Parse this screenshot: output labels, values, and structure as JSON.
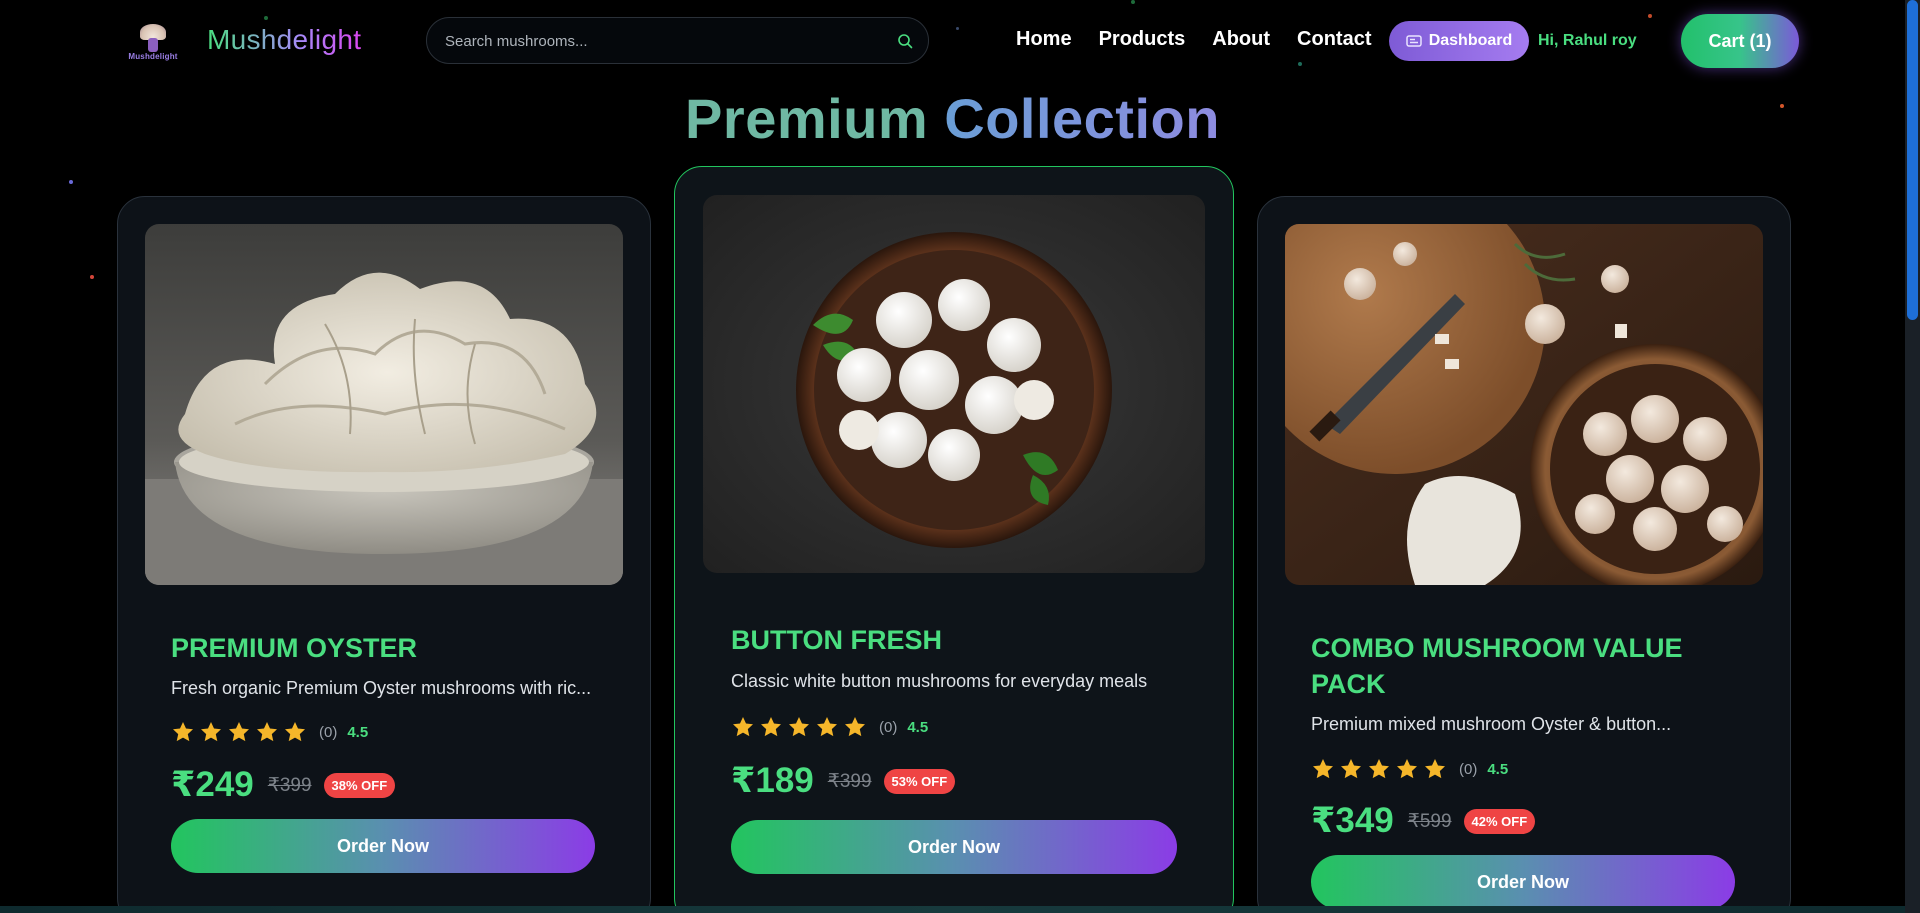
{
  "nav": {
    "logo_tiny_text": "Mushdelight",
    "brand": "Mushdelight",
    "search_placeholder": "Search mushrooms...",
    "links": [
      "Home",
      "Products",
      "About",
      "Contact"
    ],
    "dashboard_label": "Dashboard",
    "greeting": "Hi, Rahul roy",
    "cart_label": "Cart (1)"
  },
  "heading": {
    "word1": "Premium",
    "word2": "Collection"
  },
  "products": [
    {
      "title": "PREMIUM OYSTER",
      "description": "Fresh organic Premium Oyster mushrooms with ric...",
      "stars": 5,
      "reviews": "(0)",
      "rating": "4.5",
      "price": "₹249",
      "old_price": "₹399",
      "discount": "38% OFF",
      "cta": "Order Now"
    },
    {
      "title": "BUTTON FRESH",
      "description": "Classic white button mushrooms for everyday meals",
      "stars": 5,
      "reviews": "(0)",
      "rating": "4.5",
      "price": "₹189",
      "old_price": "₹399",
      "discount": "53% OFF",
      "cta": "Order Now"
    },
    {
      "title_line1": "COMBO MUSHROOM VALUE",
      "title_line2": "PACK",
      "description": "Premium mixed mushroom Oyster & button...",
      "stars": 5,
      "reviews": "(0)",
      "rating": "4.5",
      "price": "₹349",
      "old_price": "₹599",
      "discount": "42% OFF",
      "cta": "Order Now"
    }
  ],
  "colors": {
    "accent_green": "#4ade80",
    "accent_purple": "#8b3ce6",
    "discount_red": "#ef4444",
    "star_gold": "#f5b62a"
  }
}
